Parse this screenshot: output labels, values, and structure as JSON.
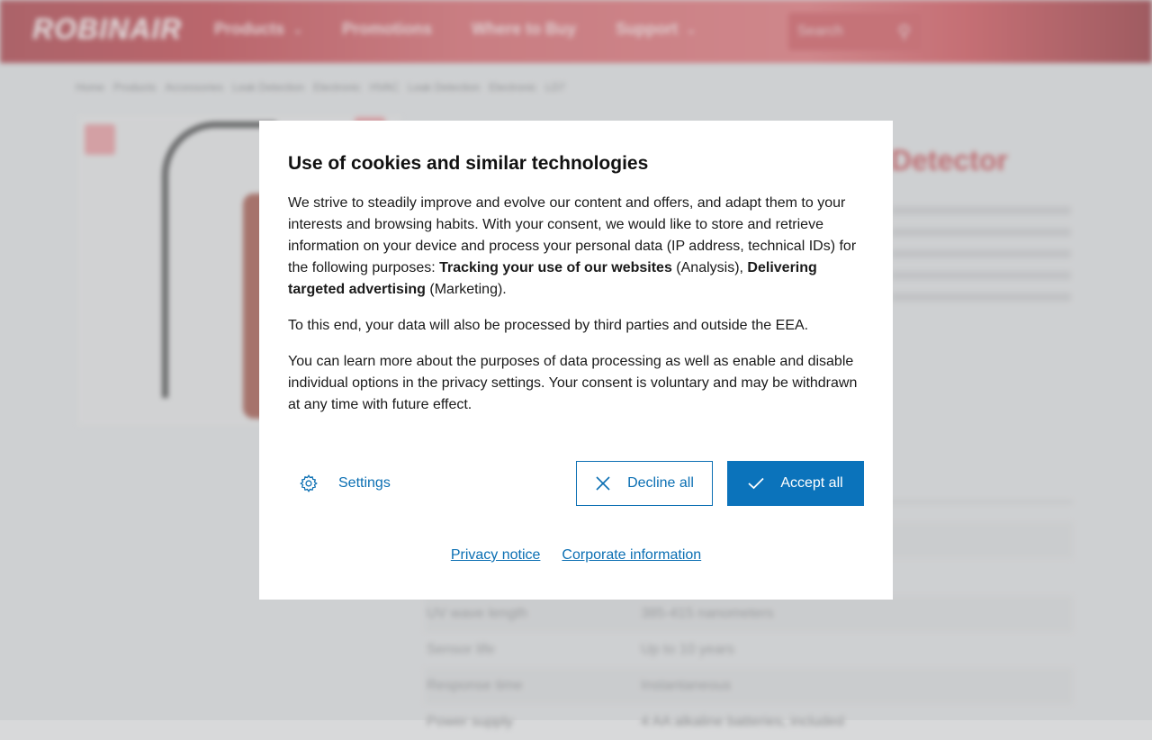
{
  "header": {
    "logo": "ROBINAIR",
    "nav": [
      {
        "label": "Products",
        "has_dropdown": true
      },
      {
        "label": "Promotions",
        "has_dropdown": false
      },
      {
        "label": "Where to Buy",
        "has_dropdown": false
      },
      {
        "label": "Support",
        "has_dropdown": true
      }
    ],
    "search_placeholder": "Search"
  },
  "breadcrumb": [
    "Home",
    "Products",
    "Accessories",
    "Leak Detection",
    "Electronic",
    "HVAC",
    "Leak Detection",
    "Electronic",
    "LD7"
  ],
  "product": {
    "title_fragment": "Detector"
  },
  "specs": [
    {
      "key": "UV wave length",
      "value": "385-415 nanometers"
    },
    {
      "key": "Sensor life",
      "value": "Up to 10 years"
    },
    {
      "key": "Response time",
      "value": "Instantaneous"
    },
    {
      "key": "Power supply",
      "value": "4 AA alkaline batteries, included"
    }
  ],
  "consent": {
    "title": "Use of cookies and similar technologies",
    "p1_a": "We strive to steadily improve and evolve our content and offers, and adapt them to your interests and browsing habits. With your consent, we would like to store and retrieve information on your device and process your personal data (IP address, technical IDs) for the following purposes: ",
    "p1_b1": "Tracking your use of our websites",
    "p1_c": " (Analysis), ",
    "p1_b2": "Delivering targeted advertising",
    "p1_d": " (Marketing).",
    "p2": "To this end, your data will also be processed by third parties and outside the EEA.",
    "p3": "You can learn more about the purposes of data processing as well as enable and disable individual options in the privacy settings. Your consent is voluntary and may be withdrawn at any time with future effect.",
    "settings_label": "Settings",
    "decline_label": "Decline all",
    "accept_label": "Accept all",
    "privacy_link": "Privacy notice",
    "corporate_link": "Corporate information",
    "colors": {
      "accent": "#0b73bb",
      "brand_red": "#c0464c"
    }
  }
}
